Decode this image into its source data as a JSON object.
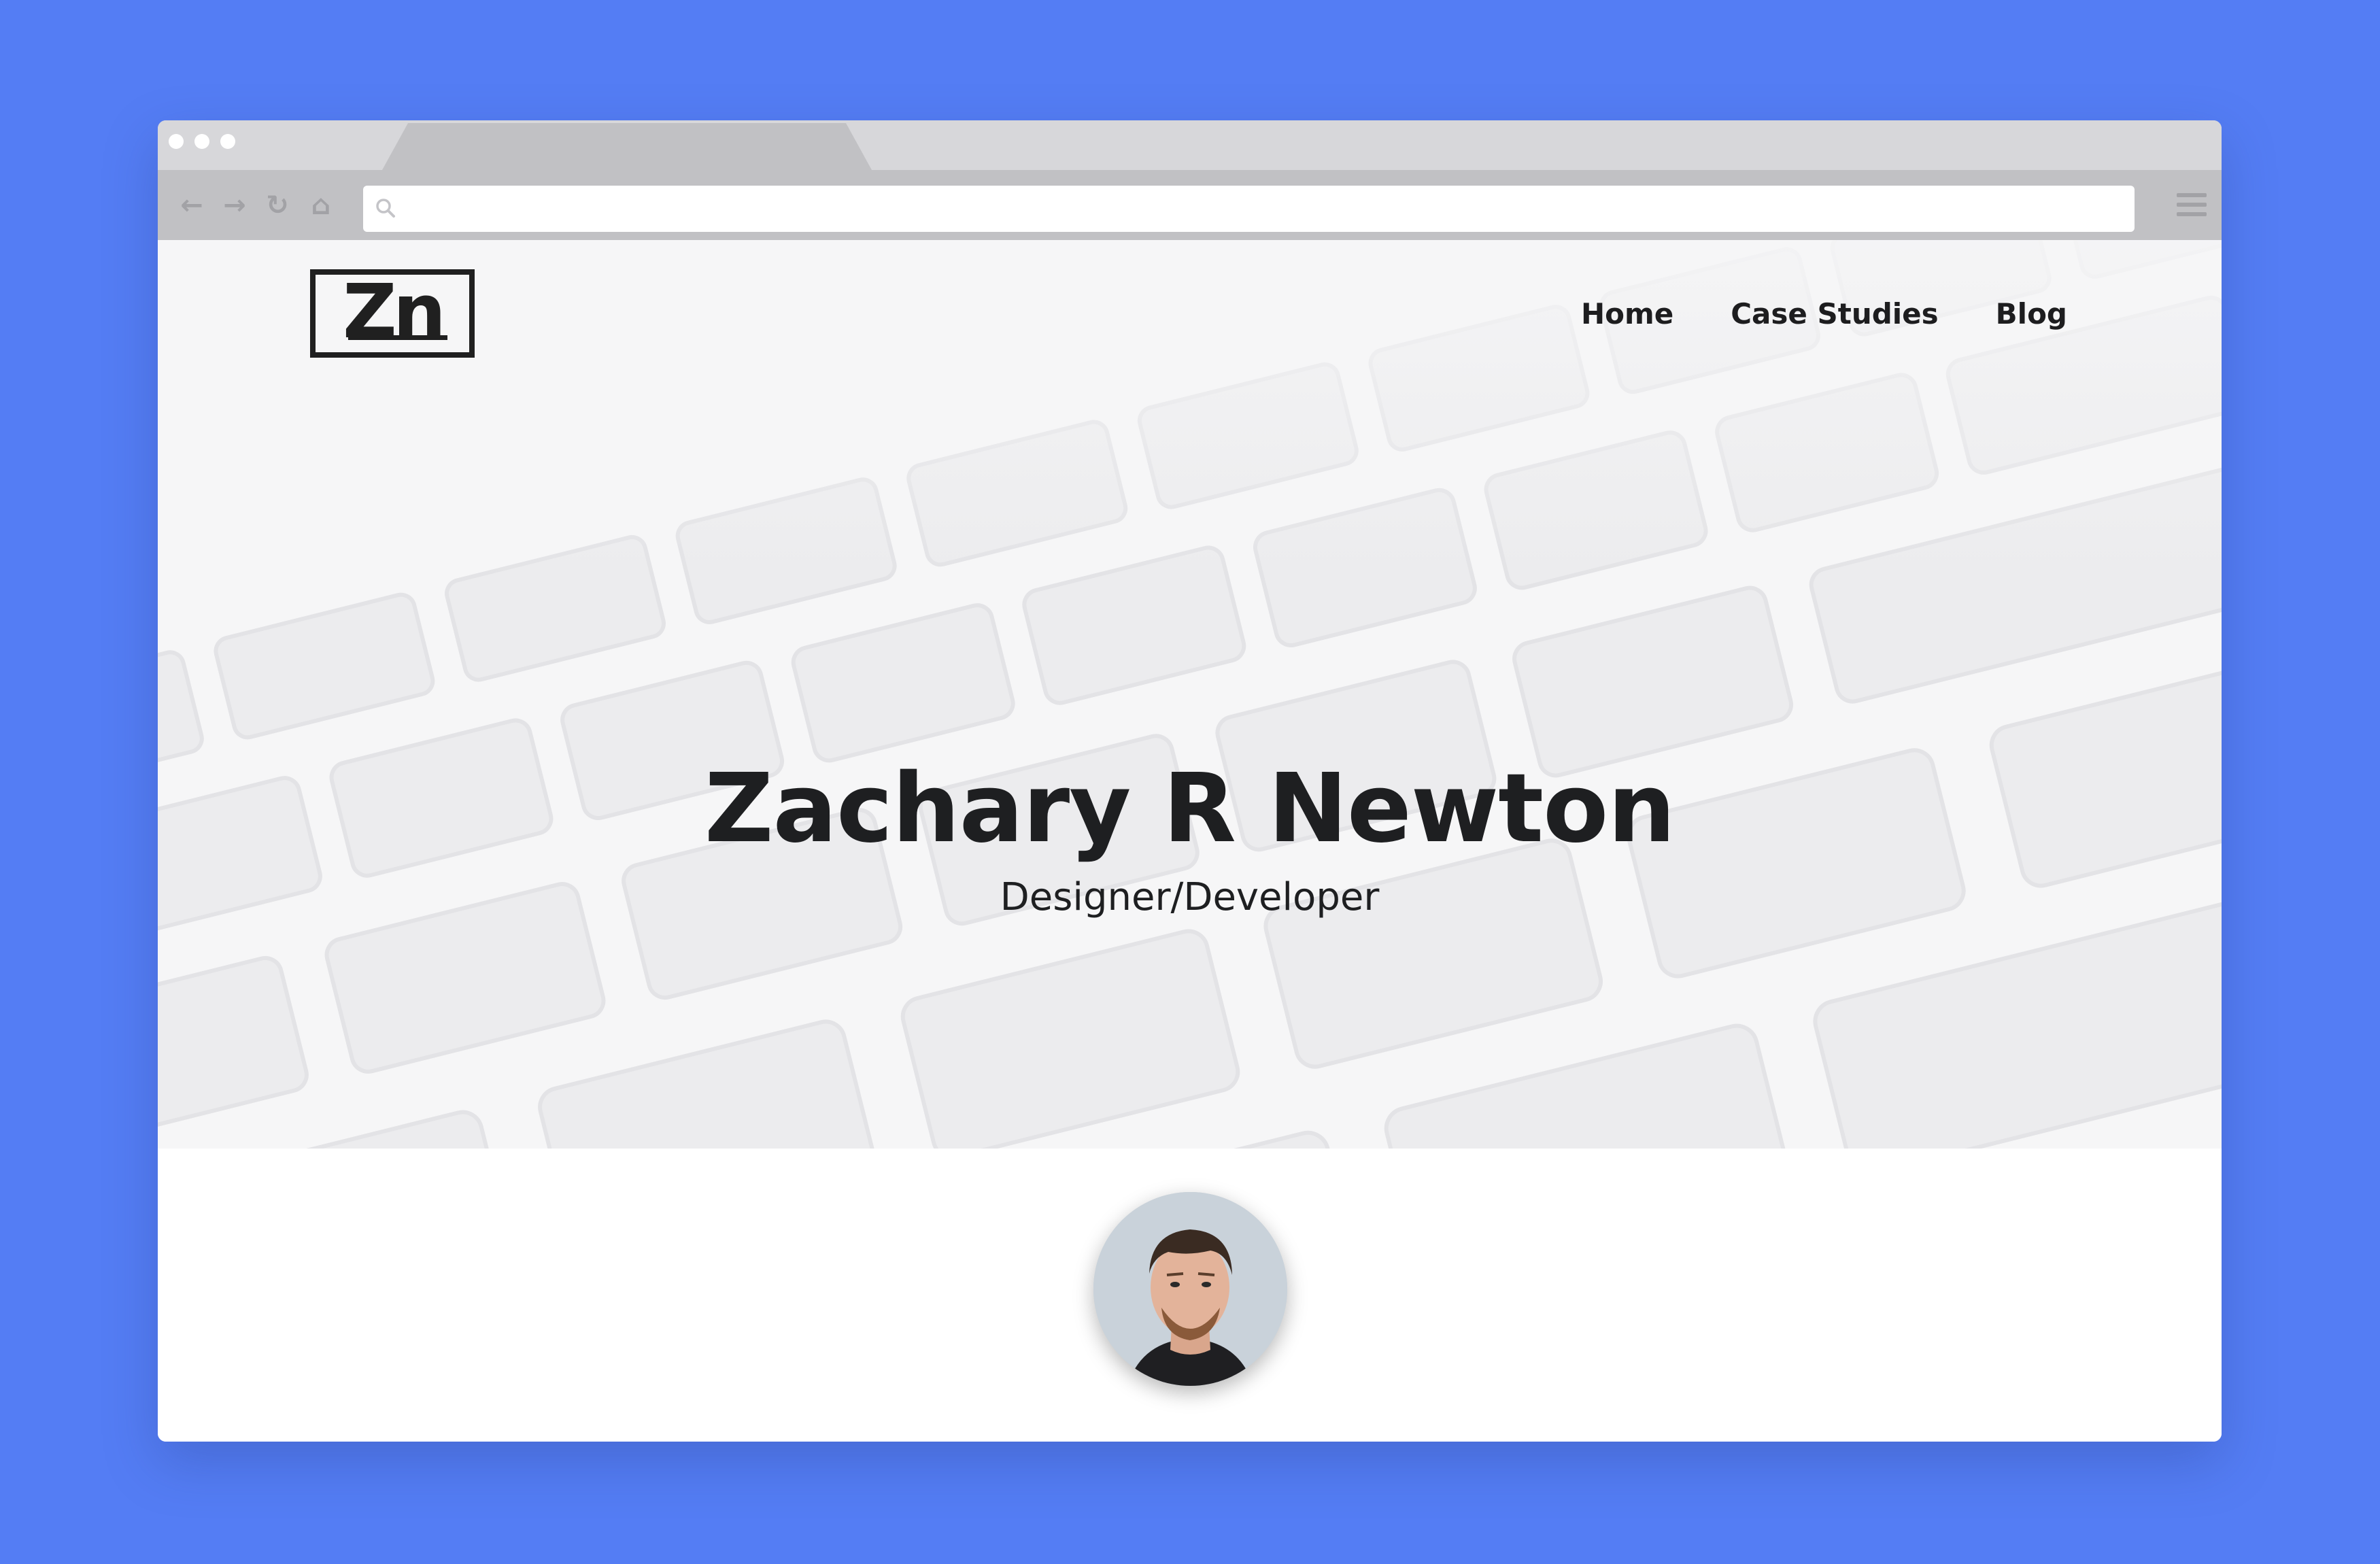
{
  "browser": {
    "tab_close_glyph": "×",
    "nav_icons": {
      "back": "←",
      "forward": "→",
      "reload": "↻",
      "home": "⌂"
    },
    "address": {
      "value": "",
      "placeholder": ""
    },
    "icons": [
      "back-arrow-icon",
      "forward-arrow-icon",
      "reload-icon",
      "home-icon",
      "search-icon",
      "hamburger-menu-icon",
      "tab-close-icon"
    ]
  },
  "site": {
    "logo_text": "Zn",
    "nav": [
      {
        "label": "Home"
      },
      {
        "label": "Case Studies"
      },
      {
        "label": "Blog"
      }
    ],
    "hero": {
      "title": "Zachary R Newton",
      "subtitle": "Designer/Developer"
    }
  },
  "colors": {
    "background": "#547df4",
    "titlebar": "#d7d7da",
    "toolbar": "#c1c1c4",
    "hero": "#f6f6f7",
    "text": "#1e1f21"
  }
}
